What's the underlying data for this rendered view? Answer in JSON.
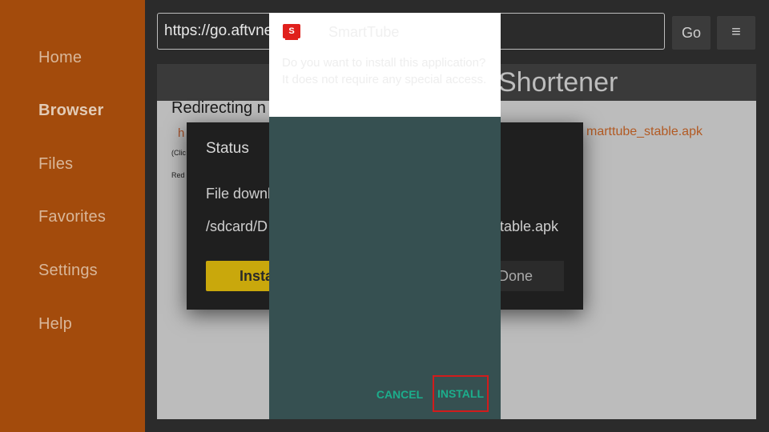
{
  "sidebar": {
    "items": [
      {
        "label": "Home"
      },
      {
        "label": "Browser"
      },
      {
        "label": "Files"
      },
      {
        "label": "Favorites"
      },
      {
        "label": "Settings"
      },
      {
        "label": "Help"
      }
    ],
    "active": "Browser"
  },
  "toolbar": {
    "url_value": "https://go.aftvnews.com/",
    "go_label": "Go",
    "menu_icon": "≡"
  },
  "webpage": {
    "header_title": "Shortener",
    "redirect_text": "Redirecting n",
    "link_fragment": "h",
    "apk_link": "marttube_stable.apk",
    "small_click_text": "(Clic",
    "small_red_text": "Red"
  },
  "status_dialog": {
    "title": "Status",
    "message": "File downl",
    "path_start": "/sdcard/D",
    "path_end": "table.apk",
    "install_label": "Insta",
    "done_label": "Done"
  },
  "installer": {
    "app_name": "SmartTube",
    "logo_letter": "S",
    "question": "Do you want to install this application? It does not require any special access.",
    "cancel_label": "CANCEL",
    "install_label": "INSTALL"
  },
  "colors": {
    "sidebar_bg": "#a34b0c",
    "installer_bg": "#365051",
    "accent_teal": "#1cae8c",
    "highlight_red": "#d11c1c",
    "status_install_yellow": "#c9a80c"
  }
}
